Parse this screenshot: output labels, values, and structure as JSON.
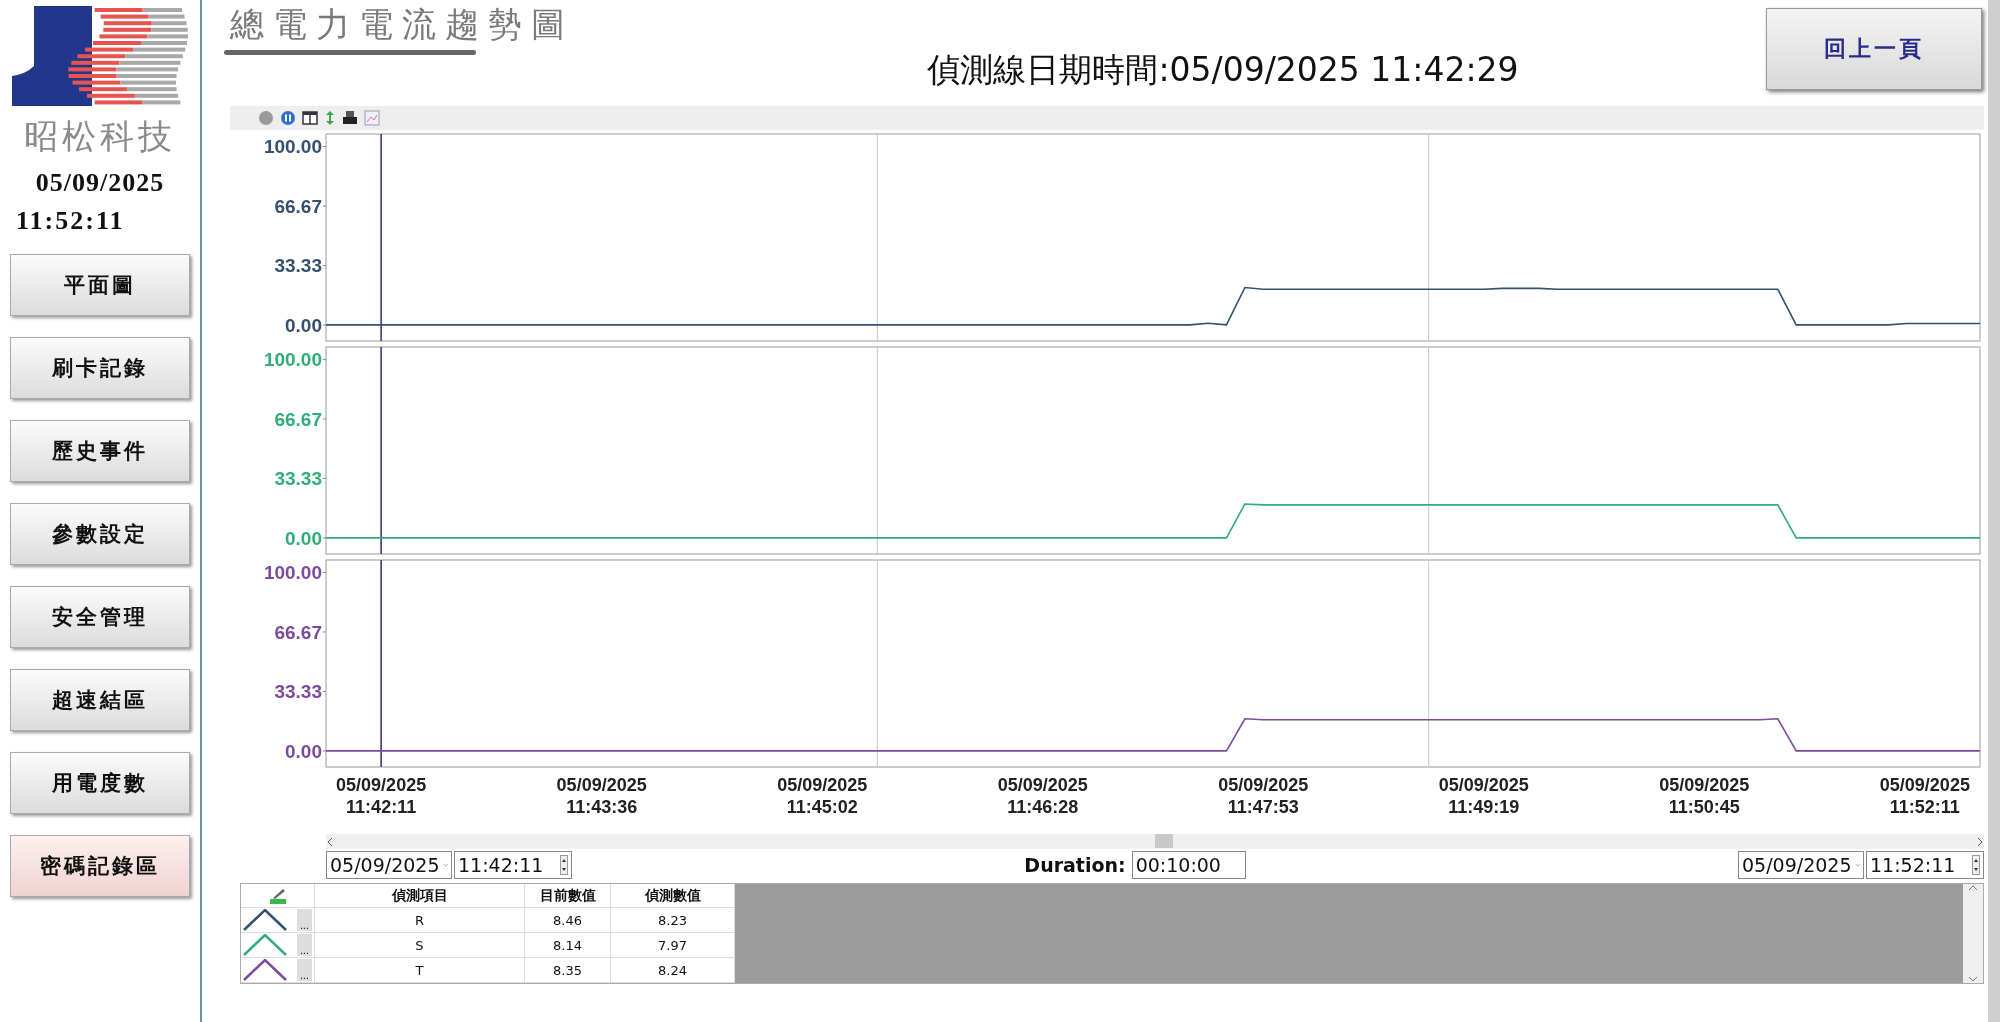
{
  "sidebar": {
    "company": "昭松科技",
    "date": "05/09/2025",
    "time": "11:52:11",
    "items": [
      {
        "label": "平面圖",
        "selected": false
      },
      {
        "label": "刷卡記錄",
        "selected": false
      },
      {
        "label": "歷史事件",
        "selected": false
      },
      {
        "label": "參數設定",
        "selected": false
      },
      {
        "label": "安全管理",
        "selected": false
      },
      {
        "label": "超速結區",
        "selected": false
      },
      {
        "label": "用電度數",
        "selected": false
      },
      {
        "label": "密碼記錄區",
        "selected": true
      }
    ]
  },
  "header": {
    "title": "總電力電流趨勢圖",
    "detection_time": "偵測線日期時間:05/09/2025 11:42:29",
    "back_button": "回上一頁"
  },
  "charts": [
    {
      "chart_data": {
        "type": "line",
        "ylim": [
          -9,
          107
        ],
        "yticks": [
          {
            "value": 0,
            "label": "0.00"
          },
          {
            "value": 33.33,
            "label": "33.33"
          },
          {
            "value": 66.67,
            "label": "66.67"
          },
          {
            "value": 100,
            "label": "100.00"
          }
        ],
        "categories": [
          null,
          null,
          null,
          null,
          null,
          null,
          null,
          null,
          null,
          null,
          null,
          null,
          null,
          null,
          null,
          null,
          null,
          null,
          null,
          null,
          null,
          null,
          null,
          null,
          null,
          null,
          null,
          null,
          null,
          null,
          null,
          null,
          null,
          null,
          null,
          null,
          null,
          null,
          null,
          null,
          null,
          null,
          null,
          null,
          null,
          null,
          null,
          null,
          null,
          null,
          null,
          null,
          null,
          null,
          null,
          null,
          null,
          null,
          null,
          null,
          null,
          null,
          null,
          null,
          null,
          null,
          null,
          null,
          null,
          null,
          null,
          null,
          null,
          null,
          null,
          null,
          null,
          null,
          null,
          null,
          null,
          null,
          null,
          null,
          null,
          null,
          null,
          null,
          null,
          null,
          null
        ],
        "series": [
          {
            "color": "#34506e",
            "values": [
              0,
              0,
              0,
              0,
              0,
              0,
              0,
              0,
              0,
              0,
              0,
              0,
              0,
              0,
              0,
              0,
              0,
              0,
              0,
              0,
              0,
              0,
              0,
              0,
              0,
              0,
              0,
              0,
              0,
              0,
              0,
              0,
              0,
              0,
              0,
              0,
              0,
              0,
              0,
              0,
              0,
              0,
              0,
              0,
              0,
              0,
              0,
              0,
              1,
              0,
              21,
              20,
              20,
              20,
              20,
              20,
              20,
              20,
              20,
              20,
              20,
              20,
              20,
              20,
              20.5,
              20.5,
              20.5,
              20,
              20,
              20,
              20,
              20,
              20,
              20,
              20,
              20,
              20,
              20,
              20,
              20,
              0,
              0,
              0,
              0,
              0,
              0,
              0.8,
              0.8,
              0.8,
              0.8,
              0.8
            ]
          }
        ]
      }
    },
    {
      "chart_data": {
        "type": "line",
        "ylim": [
          -9,
          107
        ],
        "yticks": [
          {
            "value": 0,
            "label": "0.00"
          },
          {
            "value": 33.33,
            "label": "33.33"
          },
          {
            "value": 66.67,
            "label": "66.67"
          },
          {
            "value": 100,
            "label": "100.00"
          }
        ],
        "categories": [
          null,
          null,
          null,
          null,
          null,
          null,
          null,
          null,
          null,
          null,
          null,
          null,
          null,
          null,
          null,
          null,
          null,
          null,
          null,
          null,
          null,
          null,
          null,
          null,
          null,
          null,
          null,
          null,
          null,
          null,
          null,
          null,
          null,
          null,
          null,
          null,
          null,
          null,
          null,
          null,
          null,
          null,
          null,
          null,
          null,
          null,
          null,
          null,
          null,
          null,
          null,
          null,
          null,
          null,
          null,
          null,
          null,
          null,
          null,
          null,
          null,
          null,
          null,
          null,
          null,
          null,
          null,
          null,
          null,
          null,
          null,
          null,
          null,
          null,
          null,
          null,
          null,
          null,
          null,
          null,
          null,
          null,
          null,
          null,
          null,
          null,
          null,
          null,
          null,
          null,
          null
        ],
        "series": [
          {
            "color": "#2fae78",
            "values": [
              0,
              0,
              0,
              0,
              0,
              0,
              0,
              0,
              0,
              0,
              0,
              0,
              0,
              0,
              0,
              0,
              0,
              0,
              0,
              0,
              0,
              0,
              0,
              0,
              0,
              0,
              0,
              0,
              0,
              0,
              0,
              0,
              0,
              0,
              0,
              0,
              0,
              0,
              0,
              0,
              0,
              0,
              0,
              0,
              0,
              0,
              0,
              0,
              0,
              0,
              19,
              18.5,
              18.5,
              18.5,
              18.5,
              18.5,
              18.5,
              18.5,
              18.5,
              18.5,
              18.5,
              18.5,
              18.5,
              18.5,
              18.5,
              18.5,
              18.5,
              18.5,
              18.5,
              18.5,
              18.5,
              18.5,
              18.5,
              18.5,
              18.5,
              18.5,
              18.5,
              18.5,
              18.5,
              18.5,
              0,
              0,
              0,
              0,
              0,
              0,
              0,
              0,
              0,
              0,
              0
            ]
          }
        ]
      }
    },
    {
      "chart_data": {
        "type": "line",
        "ylim": [
          -9,
          107
        ],
        "yticks": [
          {
            "value": 0,
            "label": "0.00"
          },
          {
            "value": 33.33,
            "label": "33.33"
          },
          {
            "value": 66.67,
            "label": "66.67"
          },
          {
            "value": 100,
            "label": "100.00"
          }
        ],
        "categories": [
          null,
          null,
          null,
          "05/09/2025\n11:42:11",
          null,
          null,
          null,
          null,
          null,
          null,
          null,
          null,
          null,
          null,
          null,
          "05/09/2025\n11:43:36",
          null,
          null,
          null,
          null,
          null,
          null,
          null,
          null,
          null,
          null,
          null,
          "05/09/2025\n11:45:02",
          null,
          null,
          null,
          null,
          null,
          null,
          null,
          null,
          null,
          null,
          null,
          "05/09/2025\n11:46:28",
          null,
          null,
          null,
          null,
          null,
          null,
          null,
          null,
          null,
          null,
          null,
          "05/09/2025\n11:47:53",
          null,
          null,
          null,
          null,
          null,
          null,
          null,
          null,
          null,
          null,
          null,
          "05/09/2025\n11:49:19",
          null,
          null,
          null,
          null,
          null,
          null,
          null,
          null,
          null,
          null,
          null,
          "05/09/2025\n11:50:45",
          null,
          null,
          null,
          null,
          null,
          null,
          null,
          null,
          null,
          null,
          null,
          "05/09/2025\n11:52:11",
          null,
          null,
          null
        ],
        "series": [
          {
            "color": "#7b4b9c",
            "values": [
              0,
              0,
              0,
              0,
              0,
              0,
              0,
              0,
              0,
              0,
              0,
              0,
              0,
              0,
              0,
              0,
              0,
              0,
              0,
              0,
              0,
              0,
              0,
              0,
              0,
              0,
              0,
              0,
              0,
              0,
              0,
              0,
              0,
              0,
              0,
              0,
              0,
              0,
              0,
              0,
              0,
              0,
              0,
              0,
              0,
              0,
              0,
              0,
              0,
              0,
              18,
              17.5,
              17.5,
              17.5,
              17.5,
              17.5,
              17.5,
              17.5,
              17.5,
              17.5,
              17.5,
              17.5,
              17.5,
              17.5,
              17.5,
              17.5,
              17.5,
              17.5,
              17.5,
              17.5,
              17.5,
              17.5,
              17.5,
              17.5,
              17.5,
              17.5,
              17.5,
              17.5,
              17.5,
              18,
              0,
              0,
              0,
              0,
              0,
              0,
              0,
              0,
              0,
              0,
              0
            ]
          }
        ]
      }
    }
  ],
  "range": {
    "start_date": "05/09/2025",
    "start_time": "11:42:11",
    "duration_label": "Duration:",
    "duration": "00:10:00",
    "end_date": "05/09/2025",
    "end_time": "11:52:11"
  },
  "table": {
    "columns": [
      "偵測項目",
      "目前數值",
      "偵測數值"
    ],
    "rows": [
      {
        "item": "R",
        "current": "8.46",
        "detected": "8.23",
        "button": "...",
        "color": "#34506e"
      },
      {
        "item": "S",
        "current": "8.14",
        "detected": "7.97",
        "button": "...",
        "color": "#2fae78"
      },
      {
        "item": "T",
        "current": "8.35",
        "detected": "8.24",
        "button": "...",
        "color": "#7b4b9c"
      }
    ]
  }
}
